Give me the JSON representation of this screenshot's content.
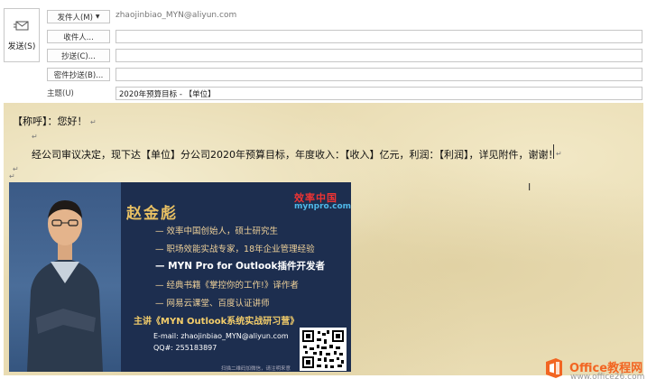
{
  "compose": {
    "send_label": "发送(S)",
    "from_button": "发件人(M)",
    "from_address": "zhaojinbiao_MYN@aliyun.com",
    "to_button": "收件人...",
    "cc_button": "抄送(C)...",
    "bcc_button": "密件抄送(B)...",
    "to_value": "",
    "cc_value": "",
    "bcc_value": "",
    "subject_label": "主题(U)",
    "subject_value": "2020年预算目标 - 【单位】"
  },
  "body": {
    "greeting": "【称呼】：您好！",
    "paragraph": "经公司审议决定，现下达【单位】分公司2020年预算目标，年度收入：【收入】亿元，利润：【利润】，详见附件，谢谢！",
    "para_mark": "↵"
  },
  "banner": {
    "name": "赵金彪",
    "logo_cn": "效率中国",
    "logo_url": "mynpro.com",
    "items": [
      "— 效率中国创始人，硕士研究生",
      "— 职场效能实战专家，18年企业管理经验",
      "— MYN Pro for Outlook插件开发者",
      "— 经典书籍《掌控你的工作!》译作者",
      "— 网易云课堂、百度认证讲师",
      "主讲《MYN Outlook系统实战研习营》"
    ],
    "email": "E-mail: zhaojinbiao_MYN@aliyun.com",
    "qq": "QQ#: 255183897",
    "footnote": "扫描二维码加微信，请注明来意"
  },
  "watermark": {
    "line1": "Office教程网",
    "line2": "www.office26.com"
  },
  "colors": {
    "stationery": "#e9dcb3",
    "banner_bg": "#1d2e4f",
    "banner_gold": "#e8c063",
    "watermark_orange": "#f26522"
  }
}
